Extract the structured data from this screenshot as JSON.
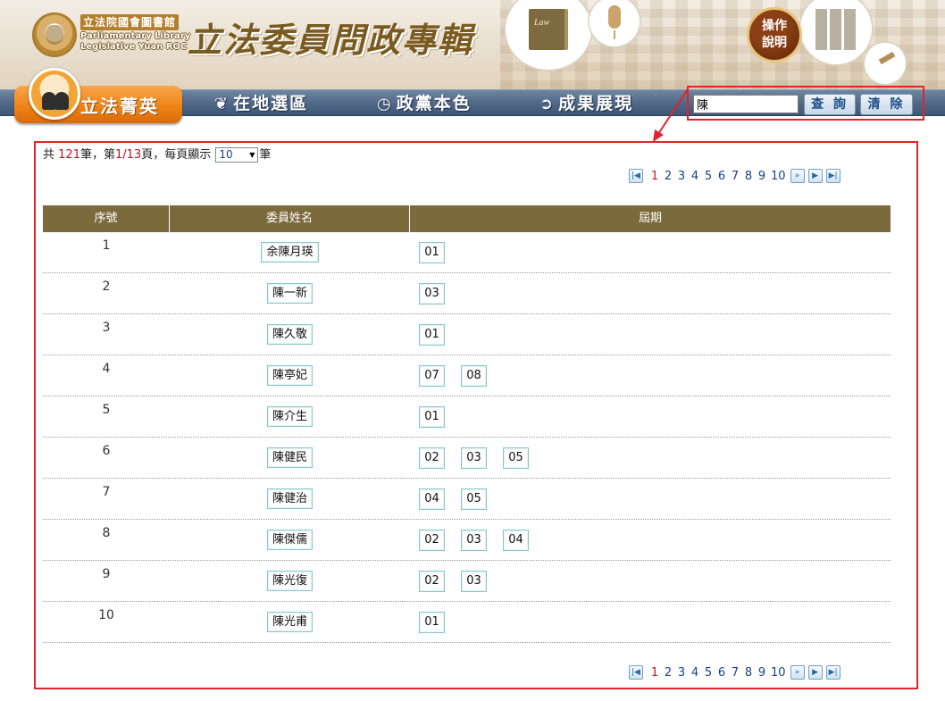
{
  "header": {
    "logo_cn": "立法院國會圖書館",
    "logo_en_line1": "Parliamentary Library",
    "logo_en_line2": "Legislative Yuan ROC",
    "site_title": "立法委員問政專輯",
    "help_label_line1": "操作",
    "help_label_line2": "說明",
    "book_label": "Law"
  },
  "nav": {
    "active": "立法菁英",
    "items": [
      "在地選區",
      "政黨本色",
      "成果展現"
    ]
  },
  "search": {
    "value": "陳",
    "query_label": "查 詢",
    "clear_label": "清 除"
  },
  "summary": {
    "prefix": "共",
    "total": "121",
    "total_suffix": "筆，第",
    "page": "1/13",
    "page_suffix": "頁，每頁顯示",
    "page_size": "10",
    "unit": "筆"
  },
  "pager": {
    "current": "1",
    "pages": [
      "1",
      "2",
      "3",
      "4",
      "5",
      "6",
      "7",
      "8",
      "9",
      "10"
    ],
    "first_icon": "first-page-icon",
    "next_group_icon": "next-group-icon",
    "next_icon": "next-page-icon",
    "last_icon": "last-page-icon"
  },
  "table": {
    "headers": [
      "序號",
      "委員姓名",
      "屆期"
    ],
    "rows": [
      {
        "no": "1",
        "name": "余陳月瑛",
        "terms": [
          "01"
        ]
      },
      {
        "no": "2",
        "name": "陳一新",
        "terms": [
          "03"
        ]
      },
      {
        "no": "3",
        "name": "陳久敬",
        "terms": [
          "01"
        ]
      },
      {
        "no": "4",
        "name": "陳亭妃",
        "terms": [
          "07",
          "08"
        ]
      },
      {
        "no": "5",
        "name": "陳介生",
        "terms": [
          "01"
        ]
      },
      {
        "no": "6",
        "name": "陳健民",
        "terms": [
          "02",
          "03",
          "05"
        ]
      },
      {
        "no": "7",
        "name": "陳健治",
        "terms": [
          "04",
          "05"
        ]
      },
      {
        "no": "8",
        "name": "陳傑儒",
        "terms": [
          "02",
          "03",
          "04"
        ]
      },
      {
        "no": "9",
        "name": "陳光復",
        "terms": [
          "02",
          "03"
        ]
      },
      {
        "no": "10",
        "name": "陳光甫",
        "terms": [
          "01"
        ]
      }
    ]
  },
  "colors": {
    "accent_orange": "#ef8417",
    "nav_blue": "#52698a",
    "table_header": "#7b6a3c",
    "highlight_red": "#e0242a",
    "link_blue": "#1b3f8b"
  }
}
